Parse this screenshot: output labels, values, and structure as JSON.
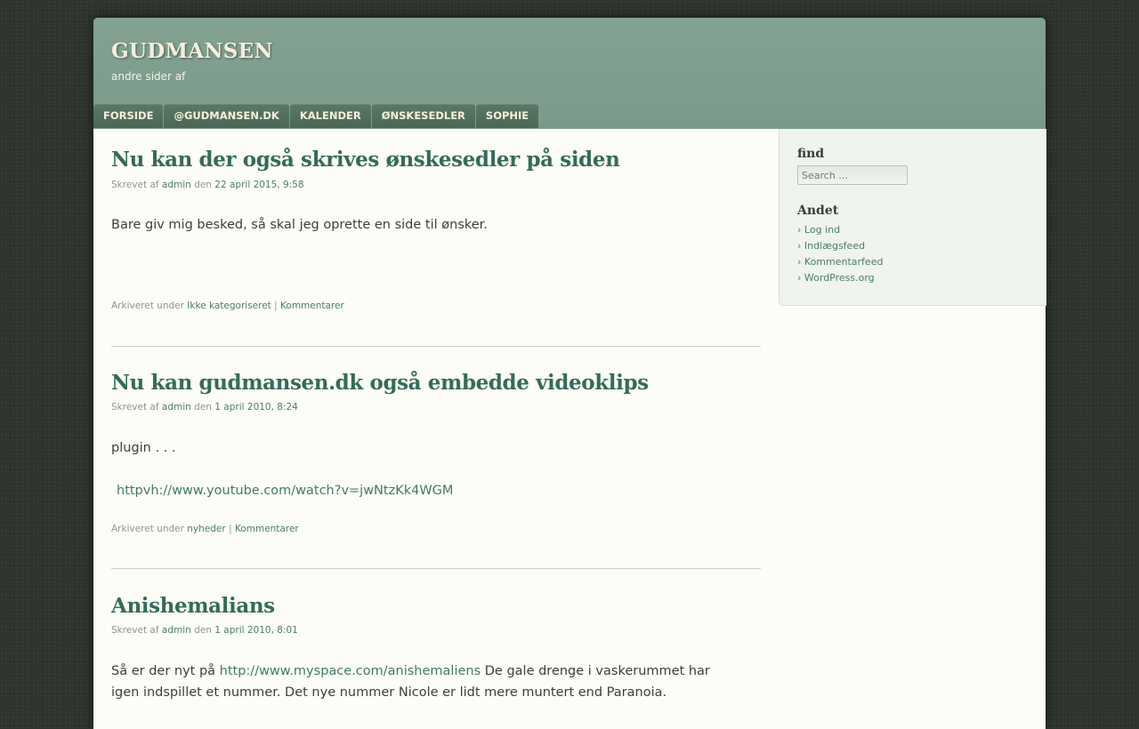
{
  "site": {
    "title": "GUDMANSEN",
    "description": "andre sider af"
  },
  "nav": {
    "items": [
      "FORSIDE",
      "@GUDMANSEN.DK",
      "KALENDER",
      "ØNSKESEDLER",
      "SOPHIE"
    ]
  },
  "posts": [
    {
      "title": "Nu kan der også skrives ønskesedler på siden",
      "meta_prefix": "Skrevet af",
      "author": "admin",
      "meta_mid": "den",
      "date": "22 april 2015, 9:58",
      "body": "Bare giv mig besked, så skal jeg oprette en side til ønsker.",
      "footer_prefix": "Arkiveret under",
      "category": "Ikke kategoriseret",
      "footer_sep": "|",
      "comments": "Kommentarer"
    },
    {
      "title": "Nu kan gudmansen.dk også embedde videoklips",
      "meta_prefix": "Skrevet af",
      "author": "admin",
      "meta_mid": "den",
      "date": "1 april 2010, 8:24",
      "body": "plugin . . .",
      "link": "httpvh://www.youtube.com/watch?v=jwNtzKk4WGM",
      "footer_prefix": "Arkiveret under",
      "category": "nyheder",
      "footer_sep": "|",
      "comments": "Kommentarer"
    },
    {
      "title": "Anishemalians",
      "meta_prefix": "Skrevet af",
      "author": "admin",
      "meta_mid": "den",
      "date": "1 april 2010, 8:01",
      "body_prefix": "Så er der nyt på",
      "body_link": "http://www.myspace.com/anishemaliens",
      "body_suffix": "De gale drenge i vaskerummet har igen indspillet et nummer. Det nye nummer Nicole er lidt mere muntert end Paranoia."
    }
  ],
  "sidebar": {
    "search_title": "find",
    "search_placeholder": "Search …",
    "other_title": "Andet",
    "links": [
      "Log ind",
      "Indlægsfeed",
      "Kommentarfeed",
      "WordPress.org"
    ]
  }
}
